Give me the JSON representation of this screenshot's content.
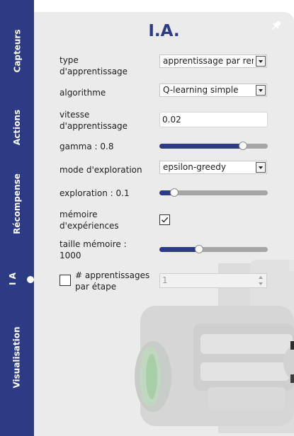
{
  "sidebar": {
    "tabs": [
      {
        "label": "Capteurs"
      },
      {
        "label": "Actions"
      },
      {
        "label": "Récompense"
      },
      {
        "label": "I A"
      },
      {
        "label": "Visualisation"
      }
    ]
  },
  "panel": {
    "title": "I.A.",
    "fields": {
      "learning_type": {
        "label": "type d'apprentissage",
        "value": "apprentissage par renforcement"
      },
      "algorithm": {
        "label": "algorithme",
        "value": "Q-learning simple"
      },
      "learning_rate": {
        "label": "vitesse d'apprentissage",
        "value": "0.02"
      },
      "gamma": {
        "label": "gamma : 0.8",
        "value": 0.8
      },
      "exploration_mode": {
        "label": "mode d'exploration",
        "value": "epsilon-greedy"
      },
      "exploration": {
        "label": "exploration : 0.1",
        "value": 0.1
      },
      "experience_memory": {
        "label": "mémoire d'expériences",
        "checked": true
      },
      "memory_size": {
        "label": "taille mémoire : 1000",
        "value": 0.35
      },
      "learnings_per_step": {
        "label": "# apprentissages par étape",
        "checked": false,
        "value": "1"
      }
    }
  },
  "colors": {
    "accent": "#2c3b84",
    "panel_bg": "#ebebeb",
    "track": "#a6a6a6"
  },
  "icons": {
    "pin": "pin-icon",
    "dropdown": "chevron-down-icon",
    "check": "check-icon"
  }
}
